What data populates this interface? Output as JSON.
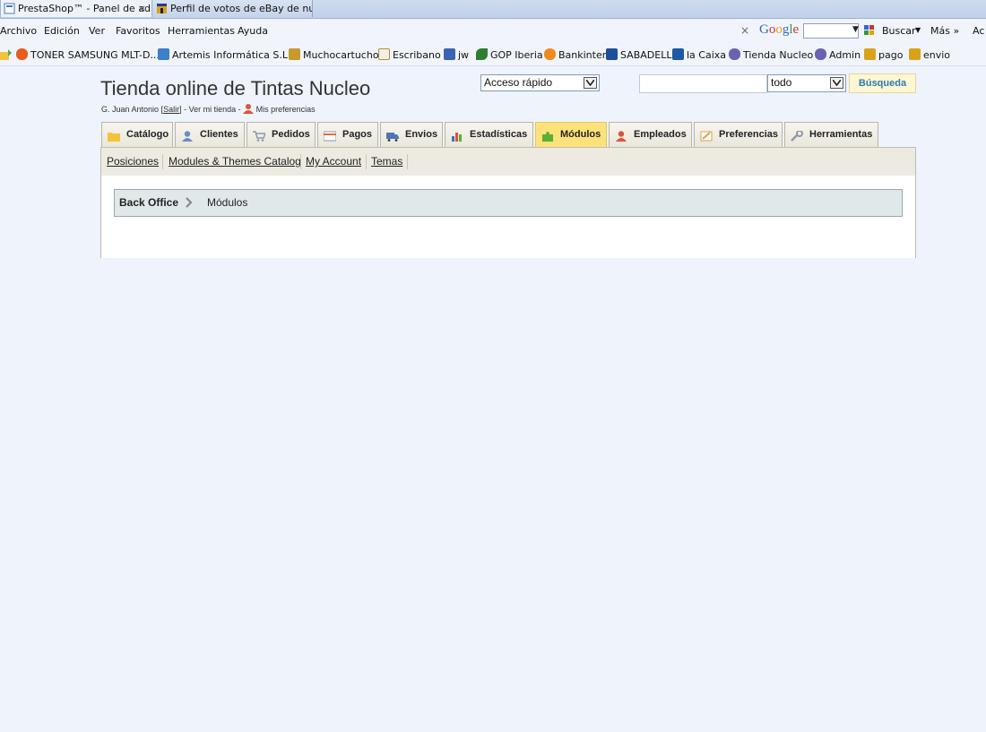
{
  "browser": {
    "tabs": [
      {
        "title": "PrestaShop™ - Panel de ad...",
        "close": "×"
      },
      {
        "title": "Perfil de votos de eBay de nucl..."
      }
    ],
    "menu": [
      "Archivo",
      "Edición",
      "Ver",
      "Favoritos",
      "Herramientas",
      "Ayuda"
    ],
    "google_toolbar": {
      "close": "×",
      "logo": "Google",
      "search_button": "Buscar",
      "more": "Más »",
      "truncated": "Ac"
    },
    "favorites": [
      {
        "label": "TONER SAMSUNG MLT-D...",
        "icon": "toner-icon",
        "color": "#e65c1c"
      },
      {
        "label": "Artemis Informática S.L.U",
        "icon": "ie-page-icon",
        "color": "#3d7fc9"
      },
      {
        "label": "Muchocartucho",
        "icon": "cartridge-icon",
        "color": "#c79a2b"
      },
      {
        "label": "Escribano",
        "icon": "escribano-icon",
        "color": "#b9893e"
      },
      {
        "label": "jw",
        "icon": "jw-icon",
        "color": "#3b63b1"
      },
      {
        "label": "GOP Iberia",
        "icon": "gop-icon",
        "color": "#2e7d32"
      },
      {
        "label": "Bankinter",
        "icon": "bankinter-icon",
        "color": "#ef8b1e"
      },
      {
        "label": "SABADELL",
        "icon": "sabadell-icon",
        "color": "#1f4e9c"
      },
      {
        "label": "la Caixa",
        "icon": "lacaixa-icon",
        "color": "#1c5aa6"
      },
      {
        "label": "Tienda Nucleo",
        "icon": "prestashop-icon",
        "color": "#6a63b3"
      },
      {
        "label": "Admin",
        "icon": "prestashop-icon",
        "color": "#6a63b3"
      },
      {
        "label": "pago",
        "icon": "ebay-icon",
        "color": "#d9a21b"
      },
      {
        "label": "envio",
        "icon": "ebay-icon",
        "color": "#d9a21b"
      }
    ]
  },
  "header": {
    "shop_title": "Tienda online de Tintas Nucleo",
    "user_name": "G. Juan Antonio",
    "logout_link": "Salir",
    "view_shop": "Ver mi tienda",
    "preferences": "Mis preferencias",
    "quick_access": "Acceso rápido",
    "search_value": "",
    "search_scope": "todo",
    "search_button": "Búsqueda"
  },
  "main_tabs": [
    {
      "label": "Catálogo",
      "icon": "folder-icon",
      "color": "#f2c43b"
    },
    {
      "label": "Clientes",
      "icon": "customer-icon",
      "color": "#6b8cc3"
    },
    {
      "label": "Pedidos",
      "icon": "cart-icon",
      "color": "#8a9aab"
    },
    {
      "label": "Pagos",
      "icon": "payment-icon",
      "color": "#e06c3f"
    },
    {
      "label": "Envios",
      "icon": "truck-icon",
      "color": "#4f76b3"
    },
    {
      "label": "Estadísticas",
      "icon": "stats-icon",
      "color": "#3f6fc0"
    },
    {
      "label": "Módulos",
      "icon": "puzzle-icon",
      "color": "#5ab033",
      "active": true
    },
    {
      "label": "Empleados",
      "icon": "employee-icon",
      "color": "#d9543a"
    },
    {
      "label": "Preferencias",
      "icon": "preferences-icon",
      "color": "#d9a34a"
    },
    {
      "label": "Herramientas",
      "icon": "wrench-icon",
      "color": "#8c9aa8"
    }
  ],
  "sub_tabs": [
    "Posiciones",
    "Modules & Themes Catalog",
    "My Account",
    "Temas"
  ],
  "breadcrumb": {
    "root": "Back Office",
    "separator": "›",
    "current": "Módulos"
  }
}
